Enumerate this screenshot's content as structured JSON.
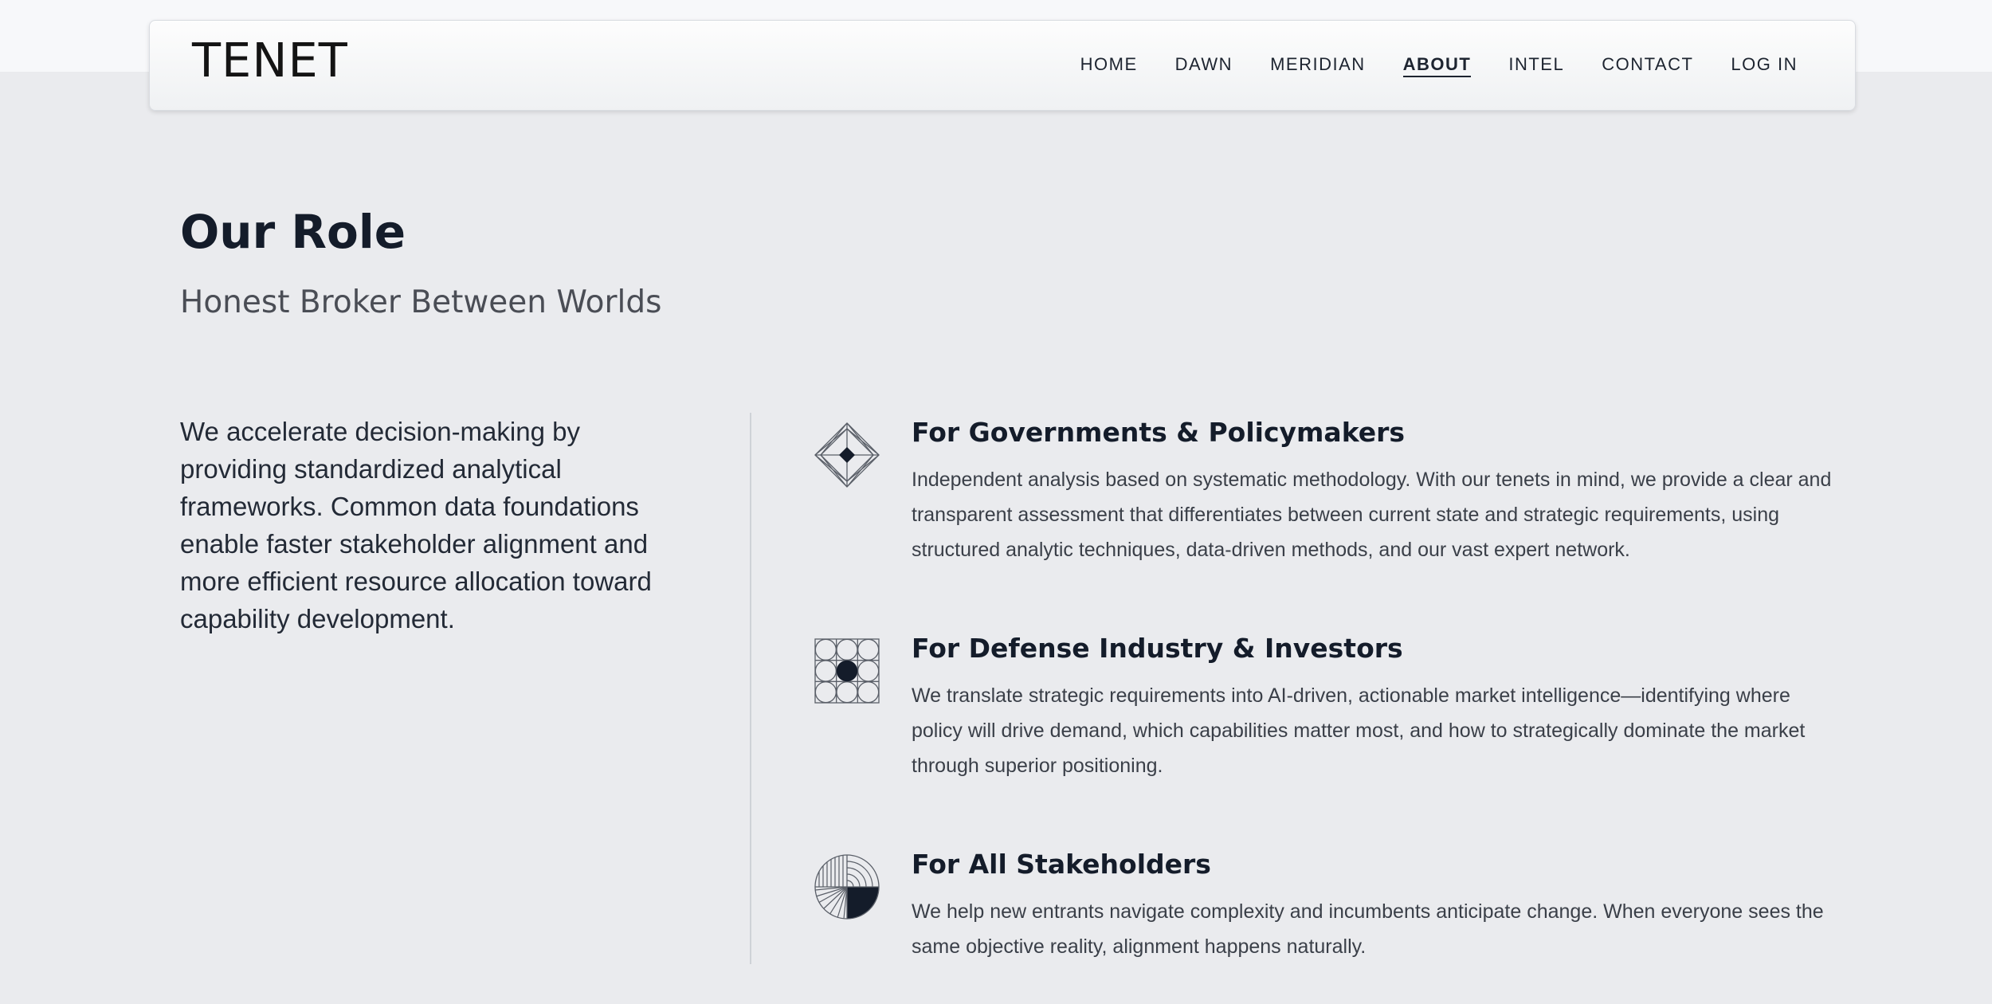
{
  "header": {
    "logo": "TENET",
    "nav": [
      {
        "label": "HOME",
        "active": false
      },
      {
        "label": "DAWN",
        "active": false
      },
      {
        "label": "MERIDIAN",
        "active": false
      },
      {
        "label": "ABOUT",
        "active": true
      },
      {
        "label": "INTEL",
        "active": false
      },
      {
        "label": "CONTACT",
        "active": false
      },
      {
        "label": "LOG IN",
        "active": false
      }
    ]
  },
  "main": {
    "title": "Our Role",
    "subtitle": "Honest Broker Between Worlds",
    "intro": "We accelerate decision-making by providing standardized analytical frameworks. Common data foundations enable faster stakeholder alignment and more efficient resource allocation toward capability development.",
    "blocks": [
      {
        "icon": "diamond-icon",
        "title": "For Governments & Policymakers",
        "text": "Independent analysis based on systematic methodology. With our tenets in mind, we provide a clear and transparent assessment that differentiates between current state and strategic requirements, using structured analytic techniques, data-driven methods, and our vast expert network."
      },
      {
        "icon": "circle-grid-icon",
        "title": "For Defense Industry & Investors",
        "text": "We translate strategic requirements into AI-driven, actionable market intelligence—identifying where policy will drive demand, which capabilities matter most, and how to strategically dominate the market through superior positioning."
      },
      {
        "icon": "quadrant-circle-icon",
        "title": "For All Stakeholders",
        "text": "We help new entrants navigate complexity and incumbents anticipate change. When everyone sees the same objective reality, alignment happens naturally."
      }
    ]
  },
  "colors": {
    "background": "#eaebee",
    "header_band": "#f7f8fa",
    "text_dark": "#141c2a",
    "text_body": "#3a3f48"
  }
}
